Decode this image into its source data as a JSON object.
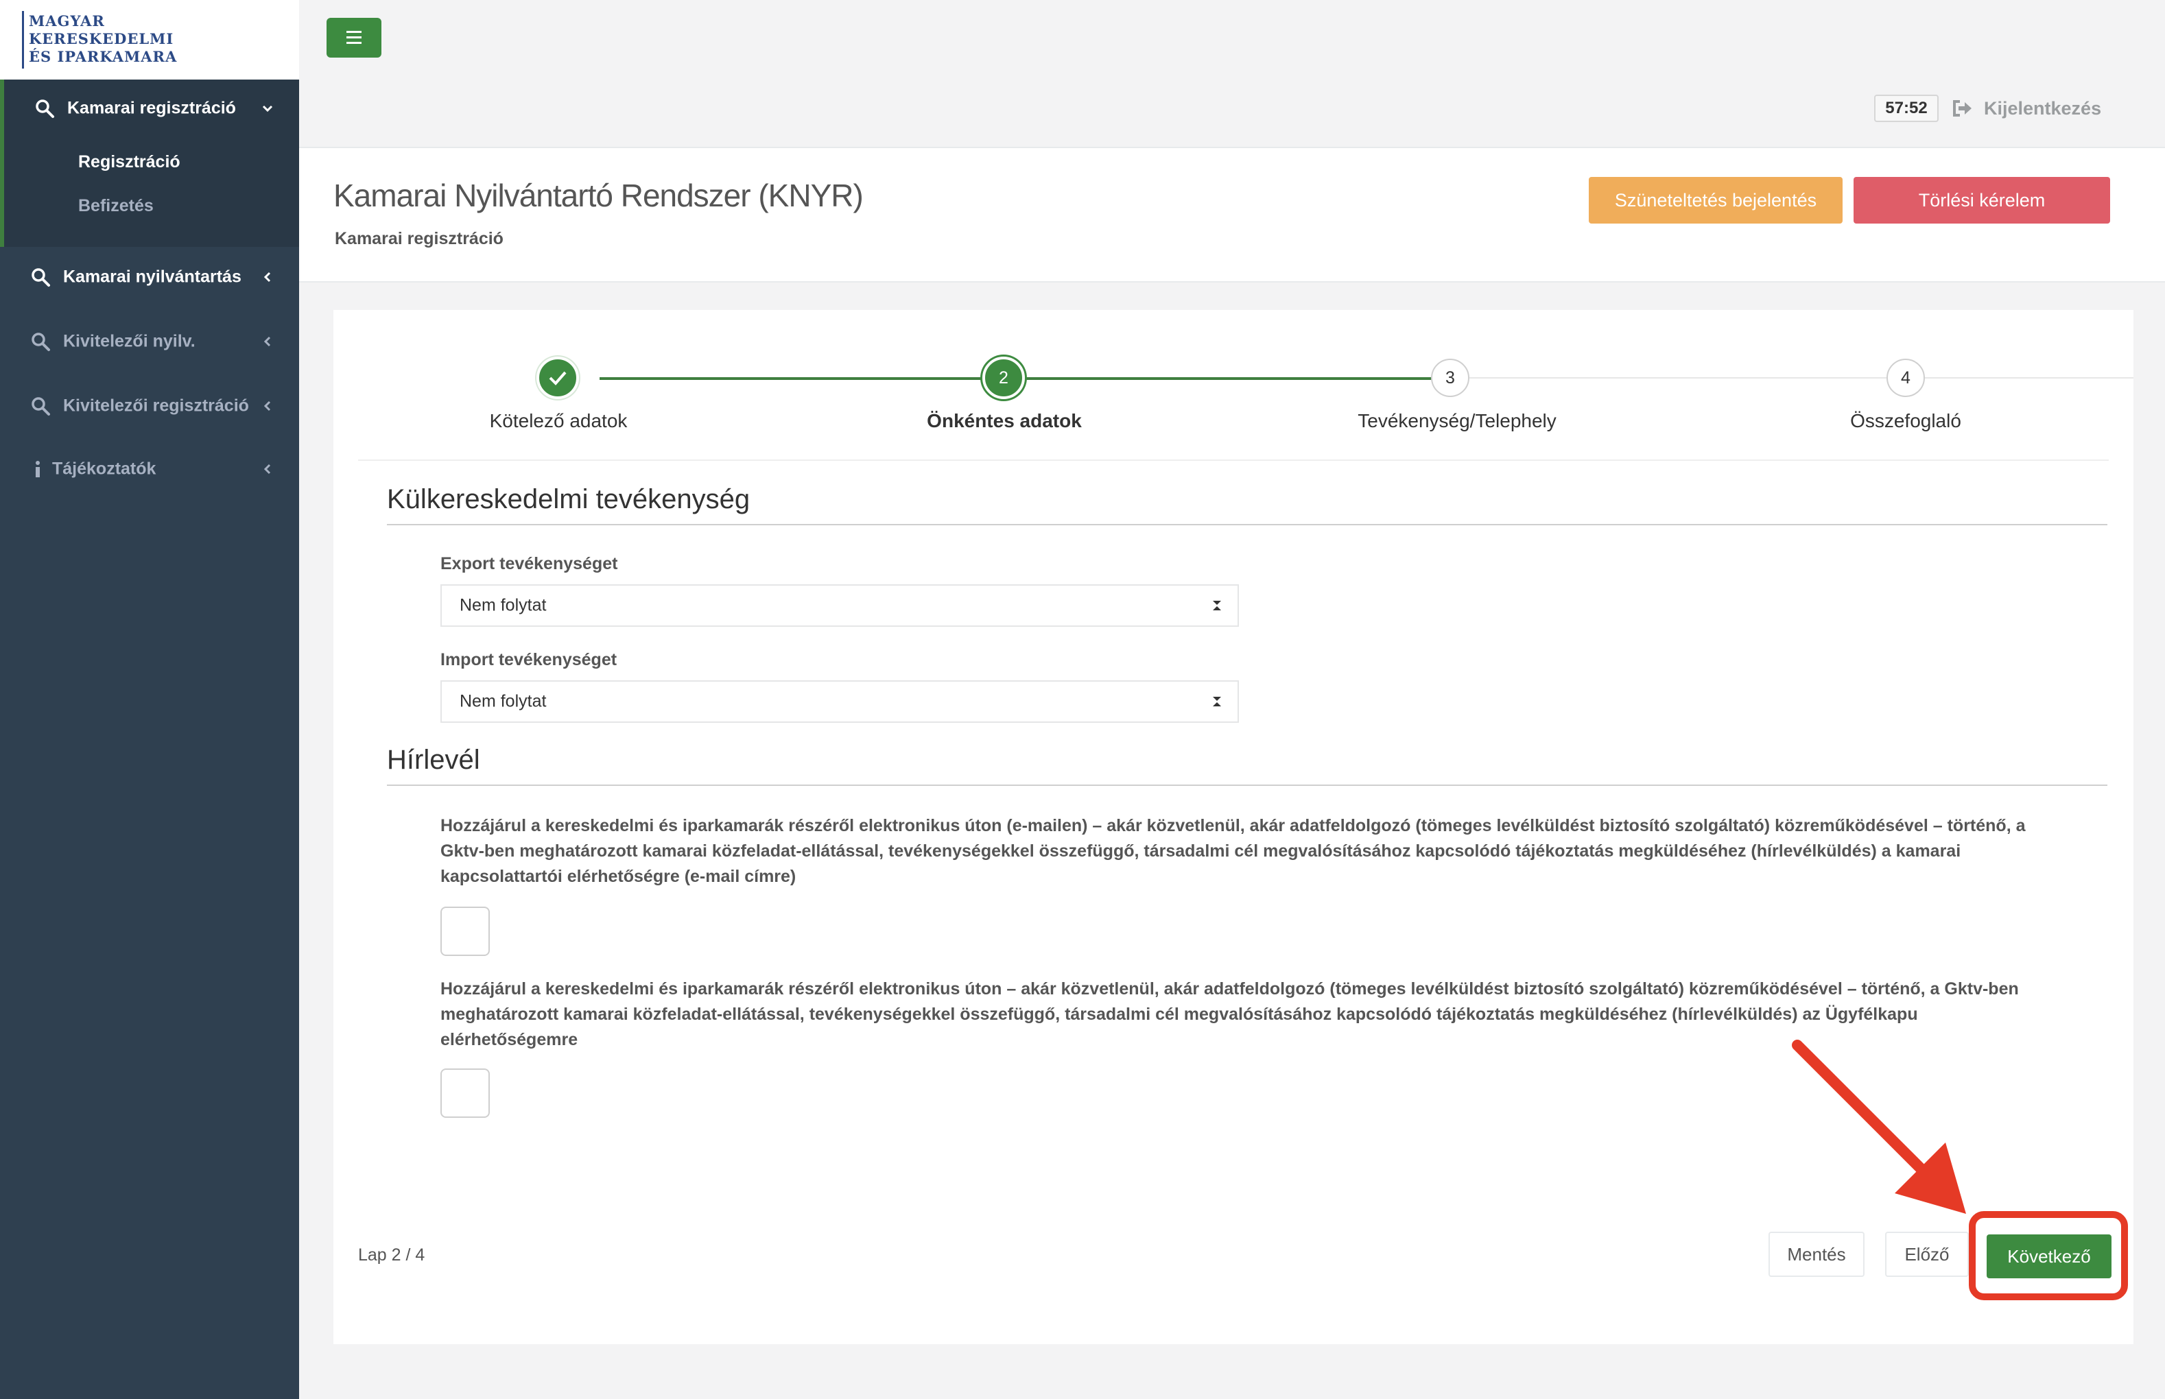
{
  "logo": {
    "line1": "Magyar",
    "line2": "Kereskedelmi",
    "line3": "És Iparkamara"
  },
  "sidebar": {
    "groups": [
      {
        "label": "Kamarai regisztráció",
        "icon": "search-icon",
        "state": "expanded",
        "children": [
          {
            "label": "Regisztráció",
            "active": true
          },
          {
            "label": "Befizetés",
            "active": false
          }
        ]
      },
      {
        "label": "Kamarai nyilvántartás",
        "icon": "search-icon",
        "state": "collapsed"
      },
      {
        "label": "Kivitelezői nyilv.",
        "icon": "search-icon",
        "state": "collapsed"
      },
      {
        "label": "Kivitelezői regisztráció",
        "icon": "search-icon",
        "state": "collapsed"
      },
      {
        "label": "Tájékoztatók",
        "icon": "info-icon",
        "state": "collapsed"
      }
    ]
  },
  "topbar": {
    "timer": "57:52",
    "logout_label": "Kijelentkezés"
  },
  "header": {
    "title": "Kamarai Nyilvántartó Rendszer (KNYR)",
    "subtitle": "Kamarai regisztráció",
    "suspend_button": "Szüneteltetés bejelentés",
    "delete_button": "Törlési kérelem"
  },
  "wizard": {
    "steps": [
      {
        "number": "1",
        "label": "Kötelező adatok",
        "status": "done"
      },
      {
        "number": "2",
        "label": "Önkéntes adatok",
        "status": "current"
      },
      {
        "number": "3",
        "label": "Tevékenység/Telephely",
        "status": "todo"
      },
      {
        "number": "4",
        "label": "Összefoglaló",
        "status": "todo"
      }
    ]
  },
  "form": {
    "trade_section_title": "Külkereskedelmi tevékenység",
    "export_label": "Export tevékenységet",
    "export_value": "Nem folytat",
    "import_label": "Import tevékenységet",
    "import_value": "Nem folytat",
    "newsletter_section_title": "Hírlevél",
    "consent_email": "Hozzájárul a kereskedelmi és iparkamarák részéről elektronikus úton (e-mailen) – akár közvetlenül, akár adatfeldolgozó (tömeges levélküldést biztosító szolgáltató) közreműködésével – történő, a Gktv-ben meghatározott kamarai közfeladat-ellátással, tevékenységekkel összefüggő, társadalmi cél megvalósításához kapcsolódó tájékoztatás megküldéséhez (hírlevélküldés) a kamarai kapcsolattartói elérhetőségre (e-mail címre)",
    "consent_email_checked": false,
    "consent_portal": "Hozzájárul a kereskedelmi és iparkamarák részéről elektronikus úton – akár közvetlenül, akár adatfeldolgozó (tömeges levélküldést biztosító szolgáltató) közreműködésével – történő, a Gktv-ben meghatározott kamarai közfeladat-ellátással, tevékenységekkel összefüggő, társadalmi cél megvalósításához kapcsolódó tájékoztatás megküldéséhez (hírlevélküldés) az Ügyfélkapu elérhetőségemre",
    "consent_portal_checked": false
  },
  "footer": {
    "page_indicator": "Lap 2 / 4",
    "save_button": "Mentés",
    "prev_button": "Előző",
    "next_button": "Következő"
  },
  "colors": {
    "sidebar": "#2f4050",
    "primary": "#3d8b40",
    "warning": "#f0ad5a",
    "danger": "#df5d68",
    "annotation": "#e53a26"
  }
}
